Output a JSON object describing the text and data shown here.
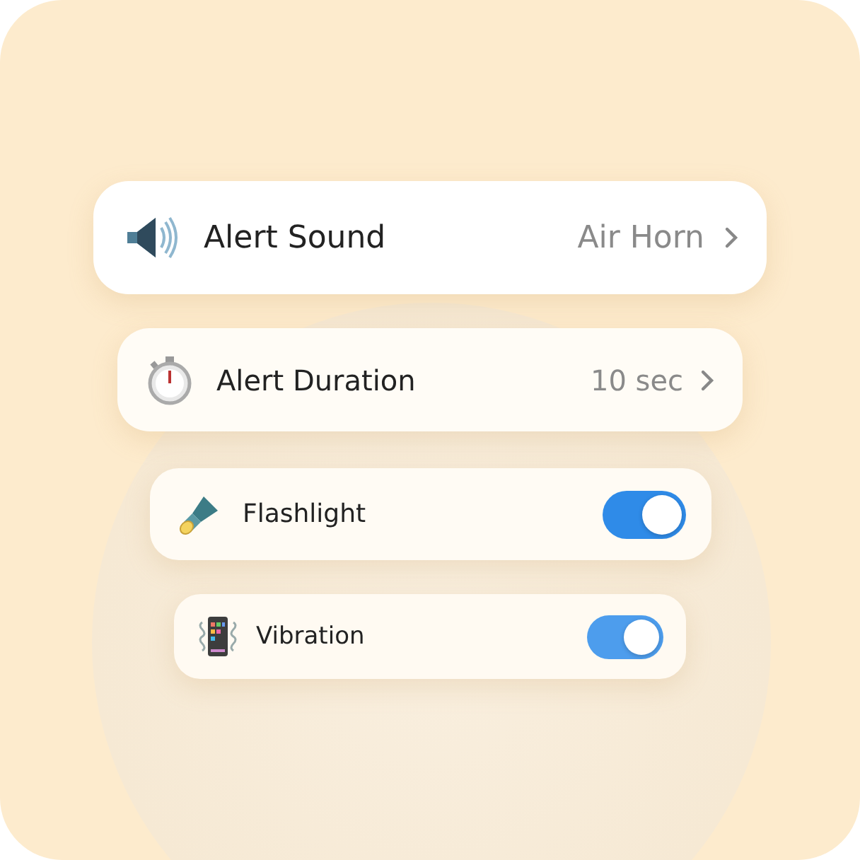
{
  "settings": [
    {
      "kind": "link",
      "label": "Alert Sound",
      "value": "Air Horn"
    },
    {
      "kind": "link",
      "label": "Alert Duration",
      "value": "10 sec"
    },
    {
      "kind": "toggle",
      "label": "Flashlight",
      "on": true
    },
    {
      "kind": "toggle",
      "label": "Vibration",
      "on": true
    }
  ]
}
